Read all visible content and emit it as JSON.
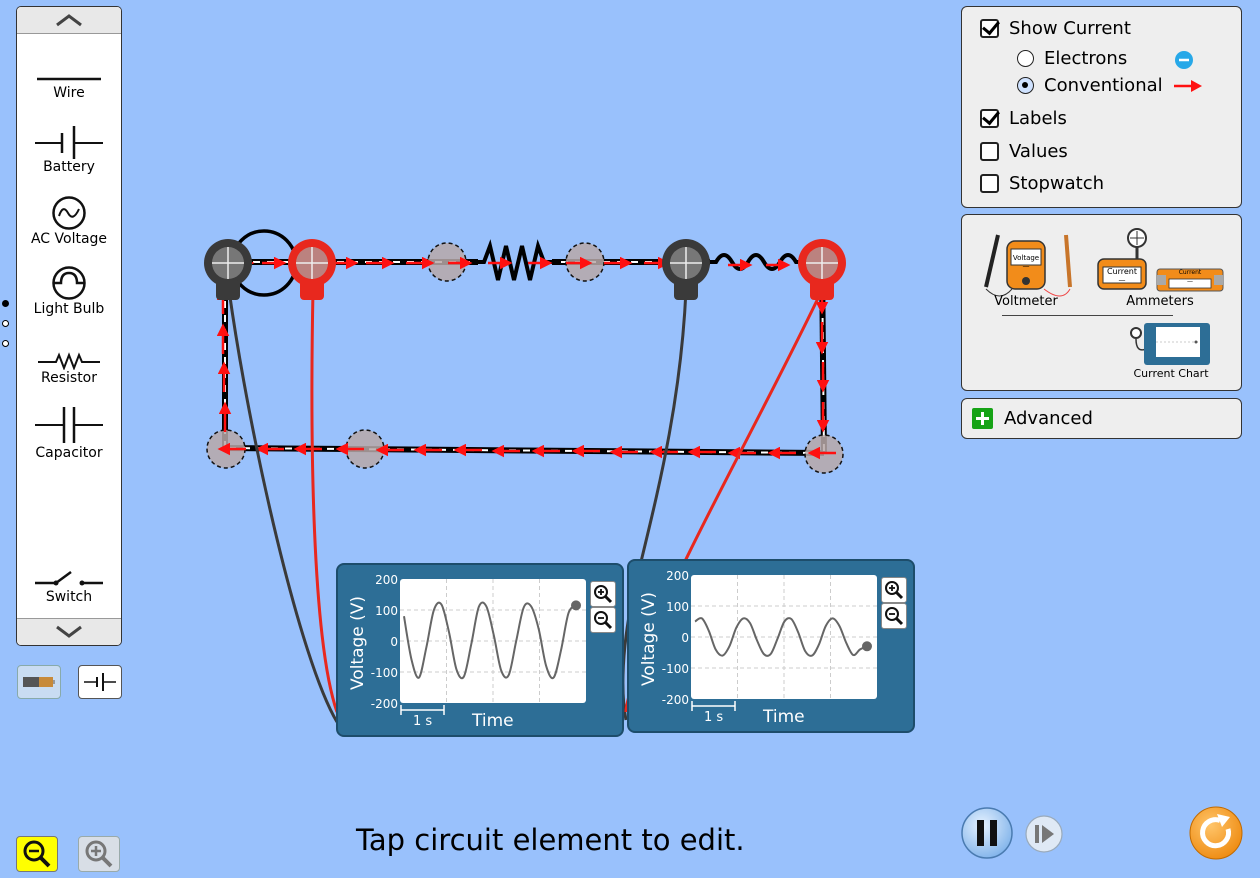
{
  "toolbox": {
    "items": [
      {
        "label": "Wire"
      },
      {
        "label": "Battery"
      },
      {
        "label": "AC Voltage"
      },
      {
        "label": "Light Bulb"
      },
      {
        "label": "Resistor"
      },
      {
        "label": "Capacitor"
      },
      {
        "label": "Switch"
      }
    ]
  },
  "view_options": {
    "show_current_label": "Show Current",
    "show_current_checked": true,
    "electrons_label": "Electrons",
    "conventional_label": "Conventional",
    "conventional_selected": true,
    "labels_label": "Labels",
    "labels_checked": true,
    "values_label": "Values",
    "values_checked": false,
    "stopwatch_label": "Stopwatch",
    "stopwatch_checked": false
  },
  "sensors": {
    "voltmeter_label": "Voltmeter",
    "ammeters_label": "Ammeters",
    "current_chart_label": "Current Chart",
    "voltage_badge": "Voltage",
    "current_badge": "Current",
    "dash": "—"
  },
  "advanced": {
    "label": "Advanced"
  },
  "charts": [
    {
      "ylabel": "Voltage (V)",
      "xlabel": "Time",
      "scale": "1 s",
      "ticks": [
        "200",
        "100",
        "0",
        "-100",
        "-200"
      ]
    },
    {
      "ylabel": "Voltage (V)",
      "xlabel": "Time",
      "scale": "1 s",
      "ticks": [
        "200",
        "100",
        "0",
        "-100",
        "-200"
      ]
    }
  ],
  "chart_data": [
    {
      "type": "line",
      "ylabel": "Voltage (V)",
      "xlabel": "Time",
      "ylim": [
        -200,
        200
      ],
      "series": [
        {
          "values": [
            80,
            -60,
            -118,
            -20,
            100,
            118,
            30,
            -90,
            -115,
            -10,
            110,
            112,
            20,
            -95,
            -110,
            0,
            108,
            112,
            40,
            -80,
            -118,
            -30,
            90,
            115
          ]
        }
      ]
    },
    {
      "type": "line",
      "ylabel": "Voltage (V)",
      "xlabel": "Time",
      "ylim": [
        -200,
        200
      ],
      "series": [
        {
          "values": [
            50,
            60,
            20,
            -40,
            -60,
            -30,
            30,
            60,
            45,
            -10,
            -55,
            -55,
            -5,
            50,
            58,
            15,
            -45,
            -60,
            -25,
            35,
            60,
            35,
            -20,
            -58,
            -40,
            -30
          ]
        }
      ]
    }
  ],
  "status_text": "Tap circuit element to edit.",
  "colors": {
    "background": "#99c1fc",
    "current_arrow": "#ff1010",
    "probe_red": "#e8281e",
    "probe_black": "#3a3a3a",
    "chart_panel": "#2d6e96",
    "restore": "#f39015",
    "zoom_out_active": "#ffff00"
  },
  "icons": {
    "electron": "electron-icon",
    "conventional": "red-arrow-icon",
    "advanced": "plus-icon",
    "pause": "pause-icon",
    "step": "step-icon",
    "reset": "reset-icon",
    "zoom_in": "zoom-in-icon",
    "zoom_out": "zoom-out-icon"
  }
}
